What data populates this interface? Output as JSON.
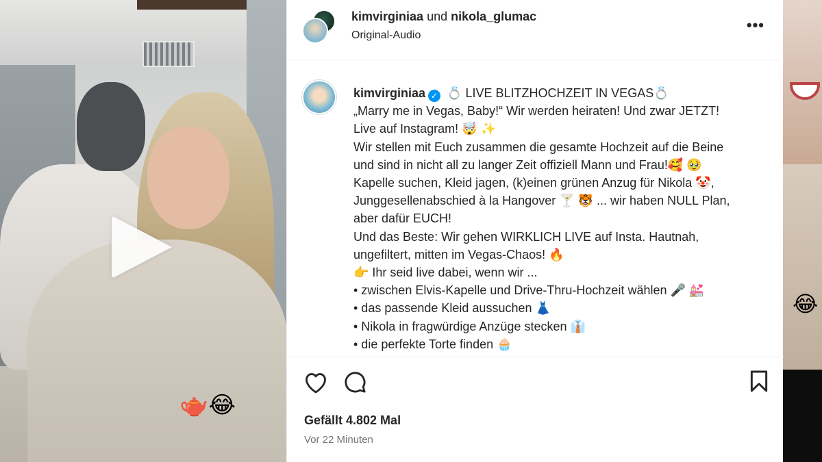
{
  "header": {
    "user1": "kimvirginiaa",
    "connector": "und",
    "user2": "nikola_glumac",
    "audio": "Original-Audio"
  },
  "caption": {
    "username": "kimvirginiaa",
    "lines": [
      "💍 LIVE BLITZHOCHZEIT IN VEGAS💍",
      "„Marry me in Vegas, Baby!“ Wir werden heiraten! Und zwar JETZT!",
      "Live auf Instagram! 🤯 ✨",
      "Wir stellen mit Euch zusammen die gesamte Hochzeit auf die Beine",
      "und sind in nicht all zu langer Zeit offiziell Mann und Frau!🥰 🥹",
      "Kapelle suchen, Kleid jagen, (k)einen grünen Anzug für Nikola 🤡,",
      "Junggesellenabschied à la Hangover 🍸 🐯 ... wir haben NULL Plan,",
      "aber dafür EUCH!",
      "Und das Beste: Wir gehen WIRKLICH LIVE auf Insta. Hautnah,",
      "ungefiltert, mitten im Vegas-Chaos! 🔥",
      "👉 Ihr seid live dabei, wenn wir ...",
      "• zwischen Elvis-Kapelle und Drive-Thru-Hochzeit wählen 🎤 💒",
      "• das passende Kleid aussuchen 👗",
      "• Nikola in fragwürdige Anzüge stecken 👔",
      "• die perfekte Torte finden 🧁"
    ]
  },
  "stats": {
    "likes": "Gefällt 4.802 Mal",
    "time": "Vor 22 Minuten"
  },
  "video": {
    "sticker": "🫖😂"
  },
  "side": {
    "emoji": "😂"
  },
  "icons": {
    "like": "heart-icon",
    "comment": "comment-icon",
    "save": "bookmark-icon",
    "more": "more-icon",
    "play": "play-icon",
    "verified": "verified-icon"
  }
}
